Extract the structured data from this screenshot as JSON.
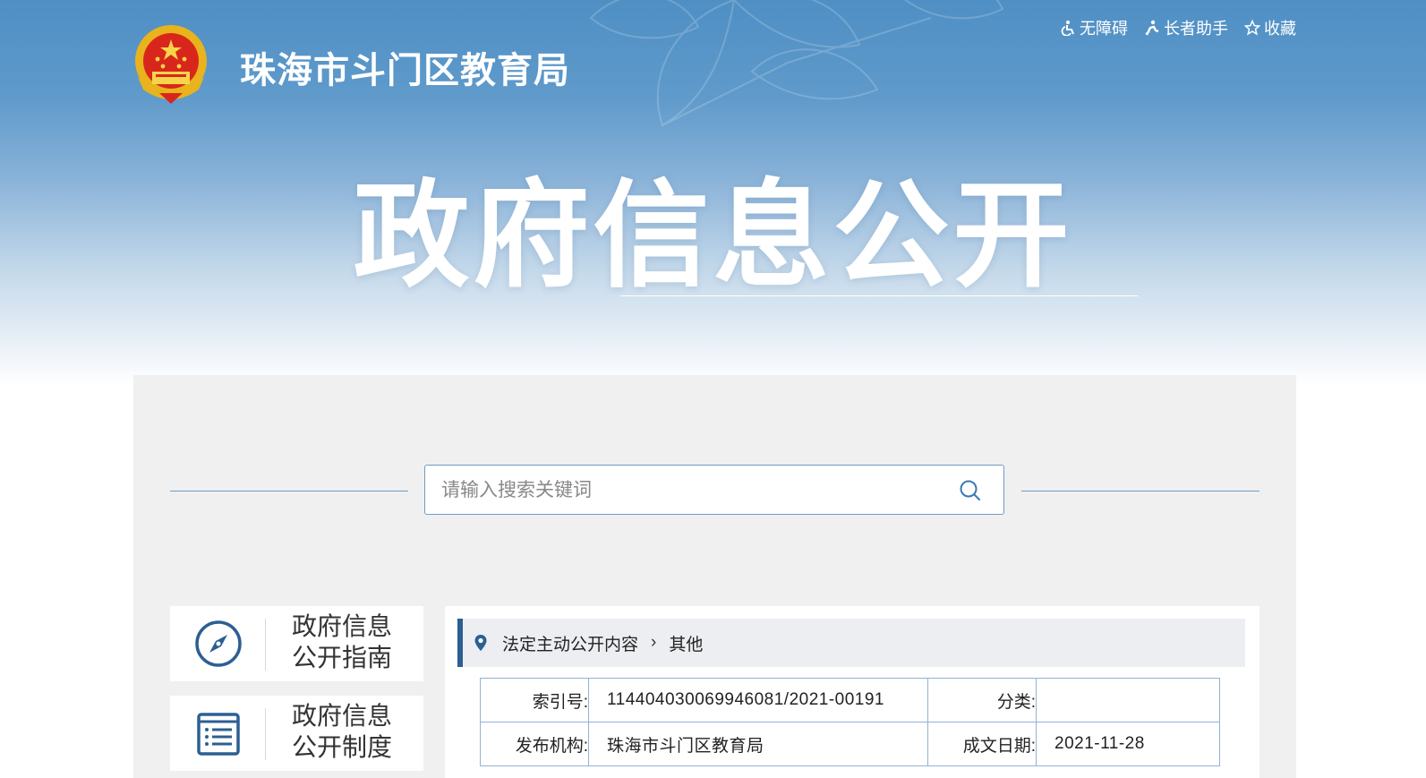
{
  "header": {
    "site_name": "珠海市斗门区教育局",
    "tools": [
      {
        "icon": "accessibility-icon",
        "label": "无障碍"
      },
      {
        "icon": "elder-helper-icon",
        "label": "长者助手"
      },
      {
        "icon": "star-icon",
        "label": "收藏"
      }
    ]
  },
  "hero": {
    "title": "政府信息公开"
  },
  "search": {
    "placeholder": "请输入搜索关键词"
  },
  "sidebar": {
    "items": [
      {
        "icon": "compass-icon",
        "line1": "政府信息",
        "line2": "公开指南"
      },
      {
        "icon": "document-list-icon",
        "line1": "政府信息",
        "line2": "公开制度"
      }
    ]
  },
  "breadcrumb": {
    "icon": "location-pin-icon",
    "items": [
      "法定主动公开内容",
      "其他"
    ]
  },
  "meta": {
    "index_label": "索引号:",
    "index_value": "114404030069946081/2021-00191",
    "category_label": "分类:",
    "category_value": "",
    "publisher_label": "发布机构:",
    "publisher_value": "珠海市斗门区教育局",
    "date_label": "成文日期:",
    "date_value": "2021-11-28"
  },
  "colors": {
    "accent": "#2c5f93",
    "border": "#8fb4d6",
    "banner_top": "#4f8fc4",
    "panel_bg": "#f0f0f0"
  }
}
